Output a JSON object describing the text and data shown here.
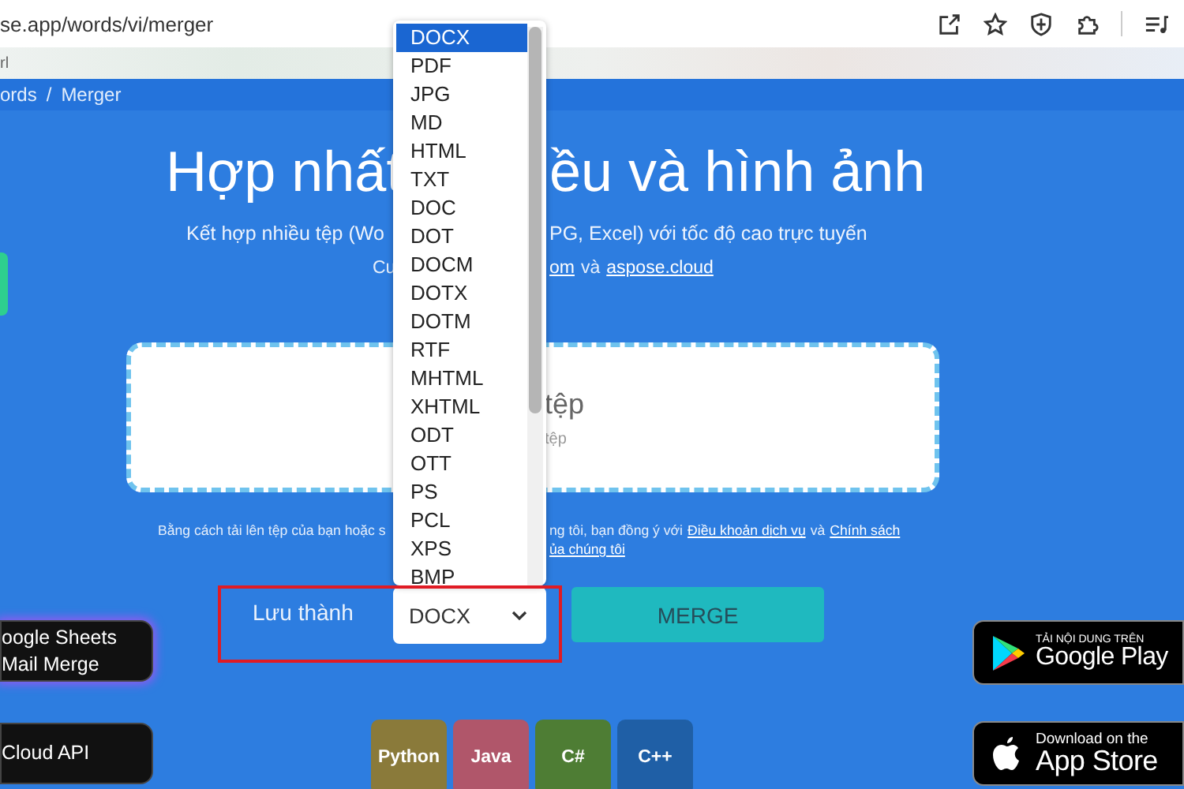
{
  "browser": {
    "url": "se.app/words/vi/merger",
    "bookmark_text": "rl"
  },
  "breadcrumb": {
    "items": [
      "ords",
      "Merger"
    ],
    "separator": "/"
  },
  "heading": {
    "left": "Hợp nhất",
    "right": "ều và hình ảnh"
  },
  "subtitle": {
    "left": "Kết hợp nhiều tệp (Wo",
    "right": "PG, Excel) với tốc độ cao trực tuyến"
  },
  "credit": {
    "left": "Cu",
    "link_1": "om",
    "joiner": "và",
    "link_2": "aspose.cloud"
  },
  "drop_zone": {
    "title": "tệp",
    "hint": "tệp"
  },
  "terms": {
    "left": "Bằng cách tải lên tệp của bạn hoặc s",
    "right": "ng tôi, bạn đồng ý với",
    "link_1": "Điều khoản dịch vụ",
    "joiner": "và",
    "link_2": "Chính sách",
    "line_2": "ủa chúng tôi"
  },
  "save_as": {
    "label": "Lưu thành",
    "value": "DOCX",
    "expanded": true,
    "options": [
      {
        "label": "DOCX",
        "selected": true
      },
      {
        "label": "PDF",
        "selected": false
      },
      {
        "label": "JPG",
        "selected": false
      },
      {
        "label": "MD",
        "selected": false
      },
      {
        "label": "HTML",
        "selected": false
      },
      {
        "label": "TXT",
        "selected": false
      },
      {
        "label": "DOC",
        "selected": false
      },
      {
        "label": "DOT",
        "selected": false
      },
      {
        "label": "DOCM",
        "selected": false
      },
      {
        "label": "DOTX",
        "selected": false
      },
      {
        "label": "DOTM",
        "selected": false
      },
      {
        "label": "RTF",
        "selected": false
      },
      {
        "label": "MHTML",
        "selected": false
      },
      {
        "label": "XHTML",
        "selected": false
      },
      {
        "label": "ODT",
        "selected": false
      },
      {
        "label": "OTT",
        "selected": false
      },
      {
        "label": "PS",
        "selected": false
      },
      {
        "label": "PCL",
        "selected": false
      },
      {
        "label": "XPS",
        "selected": false
      },
      {
        "label": "BMP",
        "selected": false
      }
    ]
  },
  "merge_button": "MERGE",
  "side_links": [
    {
      "lines": [
        "oogle Sheets",
        "Mail Merge"
      ],
      "glow": true
    },
    {
      "lines": [
        "Cloud API"
      ],
      "glow": false
    }
  ],
  "languages": [
    {
      "label": "Python",
      "color": "#8a7a3a"
    },
    {
      "label": "Java",
      "color": "#b0566a"
    },
    {
      "label": "C#",
      "color": "#4e7d34"
    },
    {
      "label": "C++",
      "color": "#1f5fa6"
    }
  ],
  "store_badges": [
    {
      "kind": "google_play",
      "caption": "TẢI NỘI DUNG TRÊN",
      "name": "Google Play"
    },
    {
      "kind": "app_store",
      "caption": "Download on the",
      "name": "App Store"
    }
  ]
}
